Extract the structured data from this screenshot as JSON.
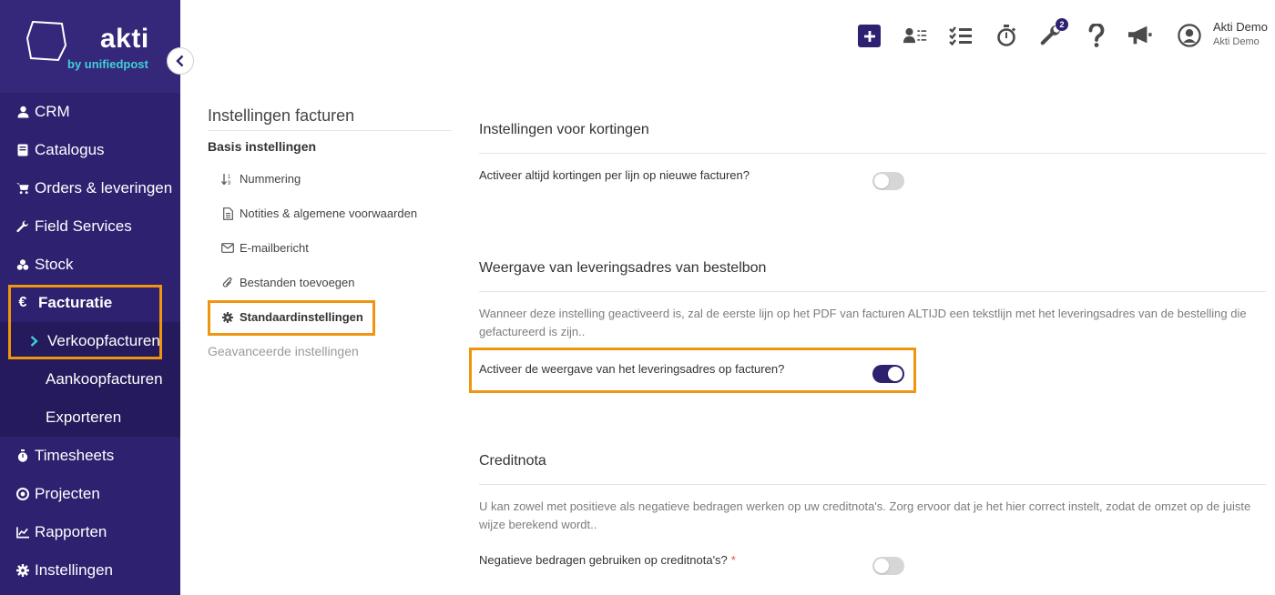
{
  "brand": {
    "name": "akti",
    "tagline": "by unifiedpost"
  },
  "sidebar": {
    "items": [
      {
        "label": "CRM",
        "icon": "user-icon"
      },
      {
        "label": "Catalogus",
        "icon": "book-icon"
      },
      {
        "label": "Orders & leveringen",
        "icon": "cart-icon"
      },
      {
        "label": "Field Services",
        "icon": "wrench-icon"
      },
      {
        "label": "Stock",
        "icon": "cubes-icon"
      },
      {
        "label": "Facturatie",
        "icon": "euro-icon",
        "active": true
      },
      {
        "label": "Timesheets",
        "icon": "stopwatch-icon"
      },
      {
        "label": "Projecten",
        "icon": "target-icon"
      },
      {
        "label": "Rapporten",
        "icon": "chart-icon"
      },
      {
        "label": "Instellingen",
        "icon": "gear-icon"
      }
    ],
    "facturatie_sub": [
      {
        "label": "Verkoopfacturen",
        "active": true
      },
      {
        "label": "Aankoopfacturen"
      },
      {
        "label": "Exporteren"
      }
    ]
  },
  "topbar": {
    "notification_count": "2",
    "user_name": "Akti Demo",
    "user_company": "Akti Demo"
  },
  "settings_menu": {
    "title": "Instellingen facturen",
    "basis_heading": "Basis instellingen",
    "items": [
      {
        "label": "Nummering",
        "icon": "sort-icon"
      },
      {
        "label": "Notities & algemene voorwaarden",
        "icon": "document-icon"
      },
      {
        "label": "E-mailbericht",
        "icon": "envelope-icon"
      },
      {
        "label": "Bestanden toevoegen",
        "icon": "paperclip-icon"
      },
      {
        "label": "Standaardinstellingen",
        "icon": "gear-icon",
        "active": true
      }
    ],
    "advanced": "Geavanceerde instellingen"
  },
  "main": {
    "sections": [
      {
        "title": "Instellingen voor kortingen",
        "description": "",
        "setting": {
          "label": "Activeer altijd kortingen per lijn op nieuwe facturen?",
          "enabled": false,
          "required": false
        }
      },
      {
        "title": "Weergave van leveringsadres van bestelbon",
        "description": "Wanneer deze instelling geactiveerd is, zal de eerste lijn op het PDF van facturen ALTIJD een tekstlijn met het leveringsadres van de bestelling die gefactureerd is zijn..",
        "setting": {
          "label": "Activeer de weergave van het leveringsadres op facturen?",
          "enabled": true,
          "required": false
        }
      },
      {
        "title": "Creditnota",
        "description": "U kan zowel met positieve als negatieve bedragen werken op uw creditnota's. Zorg ervoor dat je het hier correct instelt, zodat de omzet op de juiste wijze berekend wordt..",
        "setting": {
          "label": "Negatieve bedragen gebruiken op creditnota's?",
          "enabled": false,
          "required": true,
          "required_mark": "*"
        }
      }
    ]
  },
  "colors": {
    "sidebar": "#2d2170",
    "highlight": "#f0950f",
    "toggle_on": "#2d2170",
    "accent_teal": "#3fd0d8"
  }
}
